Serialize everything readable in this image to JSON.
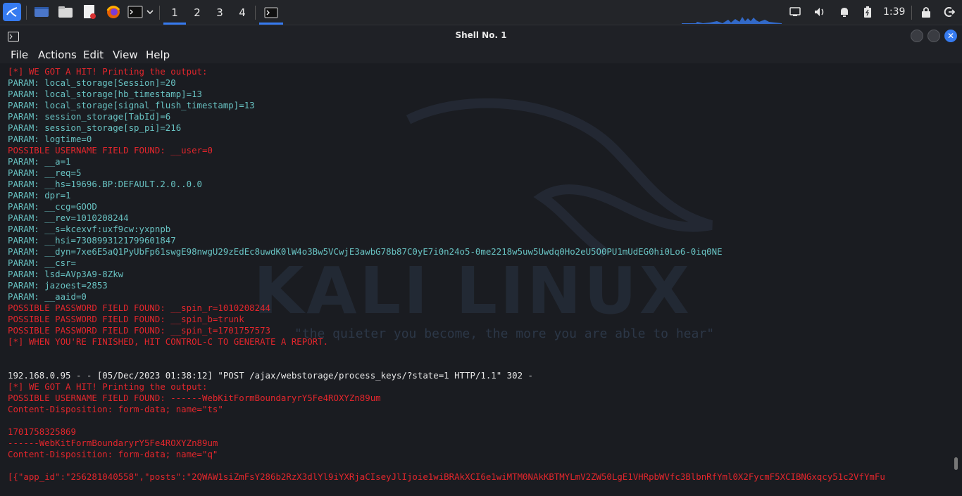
{
  "panel": {
    "workspaces": [
      "1",
      "2",
      "3",
      "4"
    ],
    "active_workspace": "1",
    "clock": "1:39",
    "apps": [
      "kali-menu-icon",
      "show-desktop-icon",
      "file-manager-icon",
      "text-editor-icon",
      "firefox-icon",
      "terminal-icon"
    ]
  },
  "window": {
    "title": "Shell No. 1",
    "menu": [
      "File",
      "Actions",
      "Edit",
      "View",
      "Help"
    ]
  },
  "watermark": {
    "title": "KALI LINUX",
    "subtitle": "\"the quieter you become, the more you are able to hear\""
  },
  "terminal": {
    "lines": [
      {
        "c": "red",
        "t": "[*] WE GOT A HIT! Printing the output:"
      },
      {
        "c": "cyan",
        "t": "PARAM: local_storage[Session]=20"
      },
      {
        "c": "cyan",
        "t": "PARAM: local_storage[hb_timestamp]=13"
      },
      {
        "c": "cyan",
        "t": "PARAM: local_storage[signal_flush_timestamp]=13"
      },
      {
        "c": "cyan",
        "t": "PARAM: session_storage[TabId]=6"
      },
      {
        "c": "cyan",
        "t": "PARAM: session_storage[sp_pi]=216"
      },
      {
        "c": "cyan",
        "t": "PARAM: logtime=0"
      },
      {
        "c": "red",
        "t": "POSSIBLE USERNAME FIELD FOUND: __user=0"
      },
      {
        "c": "cyan",
        "t": "PARAM: __a=1"
      },
      {
        "c": "cyan",
        "t": "PARAM: __req=5"
      },
      {
        "c": "cyan",
        "t": "PARAM: __hs=19696.BP:DEFAULT.2.0..0.0"
      },
      {
        "c": "cyan",
        "t": "PARAM: dpr=1"
      },
      {
        "c": "cyan",
        "t": "PARAM: __ccg=GOOD"
      },
      {
        "c": "cyan",
        "t": "PARAM: __rev=1010208244"
      },
      {
        "c": "cyan",
        "t": "PARAM: __s=kcexvf:uxf9cw:yxpnpb"
      },
      {
        "c": "cyan",
        "t": "PARAM: __hsi=7308993121799601847"
      },
      {
        "c": "cyan",
        "t": "PARAM: __dyn=7xe6E5aQ1PyUbFp61swgE98nwgU29zEdEc8uwdK0lW4o3Bw5VCwjE3awbG78b87C0yE7i0n24o5-0me2218w5uw5Uwdq0Ho2eU5O0PU1mUdEG0hi0Lo6-0iq0NE"
      },
      {
        "c": "cyan",
        "t": "PARAM: __csr="
      },
      {
        "c": "cyan",
        "t": "PARAM: lsd=AVp3A9-8Zkw"
      },
      {
        "c": "cyan",
        "t": "PARAM: jazoest=2853"
      },
      {
        "c": "cyan",
        "t": "PARAM: __aaid=0"
      },
      {
        "c": "red",
        "t": "POSSIBLE PASSWORD FIELD FOUND: __spin_r=1010208244"
      },
      {
        "c": "red",
        "t": "POSSIBLE PASSWORD FIELD FOUND: __spin_b=trunk"
      },
      {
        "c": "red",
        "t": "POSSIBLE PASSWORD FIELD FOUND: __spin_t=1701757573"
      },
      {
        "c": "red",
        "t": "[*] WHEN YOU'RE FINISHED, HIT CONTROL-C TO GENERATE A REPORT."
      },
      {
        "c": "white",
        "t": ""
      },
      {
        "c": "white",
        "t": ""
      },
      {
        "c": "white",
        "t": "192.168.0.95 - - [05/Dec/2023 01:38:12] \"POST /ajax/webstorage/process_keys/?state=1 HTTP/1.1\" 302 -"
      },
      {
        "c": "red",
        "t": "[*] WE GOT A HIT! Printing the output:"
      },
      {
        "c": "red",
        "t": "POSSIBLE USERNAME FIELD FOUND: ------WebKitFormBoundaryrY5Fe4ROXYZn89um"
      },
      {
        "c": "red",
        "t": "Content-Disposition: form-data; name=\"ts\""
      },
      {
        "c": "white",
        "t": ""
      },
      {
        "c": "red",
        "t": "1701758325869"
      },
      {
        "c": "red",
        "t": "------WebKitFormBoundaryrY5Fe4ROXYZn89um"
      },
      {
        "c": "red",
        "t": "Content-Disposition: form-data; name=\"q\""
      },
      {
        "c": "white",
        "t": ""
      },
      {
        "c": "red",
        "t": "[{\"app_id\":\"256281040558\",\"posts\":\"2QWAW1siZmFsY286b2RzX3dlYl9iYXRjaCIseyJlIjoie1wiBRAkXCI6e1wiMTM0NAkKBTMYLmV2ZW50LgE1VHRpbWVfc3BlbnRfYml0X2FycmF5XCIBNGxqcy51c2VfYmFu"
      }
    ]
  },
  "colors": {
    "accent": "#367bf0",
    "red": "#e3262c",
    "cyan": "#68c2c2",
    "white": "#e8e8e8"
  }
}
